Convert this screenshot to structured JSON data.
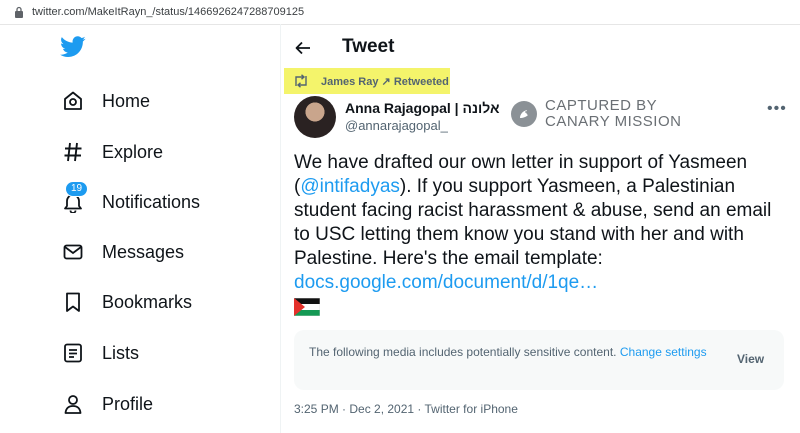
{
  "browser": {
    "url": "twitter.com/MakeItRayn_/status/1466926247288709125"
  },
  "nav": {
    "items": [
      {
        "label": "Home",
        "icon": "home-icon"
      },
      {
        "label": "Explore",
        "icon": "hashtag-icon"
      },
      {
        "label": "Notifications",
        "icon": "bell-icon",
        "badge": "19"
      },
      {
        "label": "Messages",
        "icon": "envelope-icon"
      },
      {
        "label": "Bookmarks",
        "icon": "bookmark-icon"
      },
      {
        "label": "Lists",
        "icon": "list-icon"
      },
      {
        "label": "Profile",
        "icon": "person-icon"
      }
    ]
  },
  "header": {
    "title": "Tweet"
  },
  "retweet": {
    "text": "James Ray ↗ Retweeted",
    "highlight_color": "#f4f46b"
  },
  "author": {
    "name": "Anna Rajagopal | אלונה",
    "handle": "@annarajagopal_"
  },
  "watermark": {
    "line1": "CAPTURED BY",
    "line2": "CANARY MISSION"
  },
  "tweet": {
    "text_1": "We have drafted our own letter in support of Yasmeen (",
    "mention": "@intifadyas",
    "text_2": "). If you support Yasmeen, a Palestinian student facing racist harassment & abuse, send an email to USC letting them know you stand with her and with Palestine. Here's the email template: ",
    "link": "docs.google.com/document/d/1qe…"
  },
  "sensitive": {
    "message": "The following media includes potentially sensitive content.",
    "change_label": "Change settings",
    "view_label": "View"
  },
  "meta": {
    "timestamp": "3:25 PM · Dec 2, 2021 · Twitter for iPhone"
  },
  "colors": {
    "accent": "#1d9bf0",
    "text": "#0f1419",
    "secondary": "#536471"
  }
}
